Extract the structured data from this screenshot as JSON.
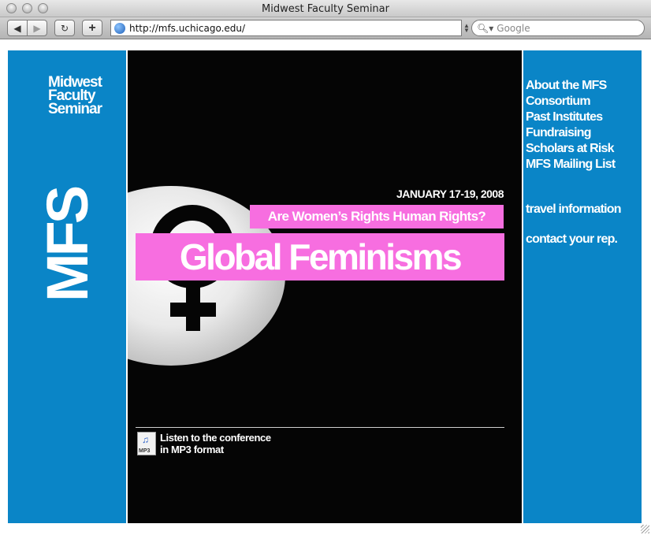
{
  "browser": {
    "window_title": "Midwest Faculty Seminar",
    "back_icon": "◀",
    "forward_icon": "▶",
    "reload_icon": "↻",
    "add_icon": "+",
    "url": "http://mfs.uchicago.edu/",
    "search_placeholder": "Google",
    "search_icon": "magnifier-icon"
  },
  "left": {
    "site_name": "Midwest Faculty Seminar",
    "logo_text": "MFS"
  },
  "banner": {
    "date": "JANUARY 17-19, 2008",
    "subtitle": "Are Women’s Rights Human Rights?",
    "headline": "Global Feminisms",
    "audio_link_line1": "Listen to the conference",
    "audio_link_line2": "in MP3 format",
    "mp3_icon_label": "MP3",
    "accent_color": "#f76ee0"
  },
  "nav": {
    "items": [
      {
        "label": "About the MFS"
      },
      {
        "label": "Consortium"
      },
      {
        "label": "Past Institutes"
      },
      {
        "label": "Fundraising"
      },
      {
        "label": "Scholars at Risk"
      },
      {
        "label": "MFS Mailing List"
      }
    ],
    "travel": "travel information",
    "contact": "contact your rep."
  },
  "colors": {
    "brand_blue": "#0a85c7",
    "background_dark": "#050505"
  }
}
